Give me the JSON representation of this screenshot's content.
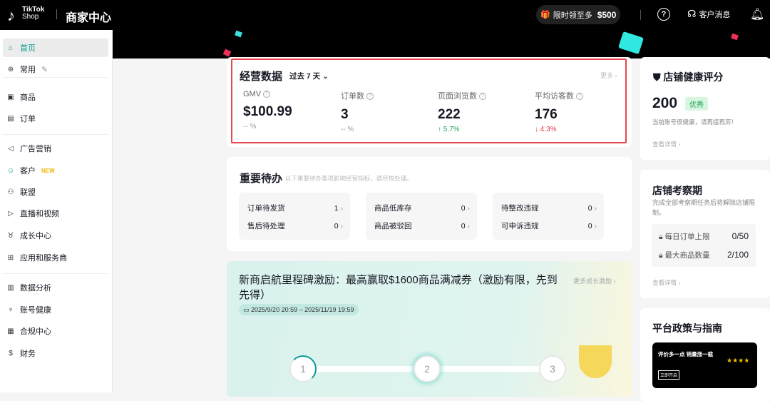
{
  "header": {
    "logo_line1": "TikTok",
    "logo_line2": "Shop",
    "title": "商家中心",
    "promo_text": "限时领至多",
    "promo_amount": "$500",
    "help_icon": "question-circle-icon",
    "support_label": "客户消息",
    "bell_icon": "bell-icon"
  },
  "sidebar": {
    "items": [
      {
        "label": "首页",
        "icon": "home-icon"
      },
      {
        "label": "常用",
        "icon": "star-circle-icon"
      },
      {
        "label": "商品",
        "icon": "box-icon"
      },
      {
        "label": "订单",
        "icon": "clipboard-icon"
      },
      {
        "label": "广告营销",
        "icon": "megaphone-icon"
      },
      {
        "label": "客户",
        "icon": "customer-icon",
        "badge": "NEW"
      },
      {
        "label": "联盟",
        "icon": "people-icon"
      },
      {
        "label": "直播和视频",
        "icon": "video-icon"
      },
      {
        "label": "成长中心",
        "icon": "growth-icon"
      },
      {
        "label": "应用和服务商",
        "icon": "apps-icon"
      },
      {
        "label": "数据分析",
        "icon": "chart-icon"
      },
      {
        "label": "账号健康",
        "icon": "trophy-icon"
      },
      {
        "label": "合规中心",
        "icon": "document-icon"
      },
      {
        "label": "财务",
        "icon": "finance-icon"
      }
    ]
  },
  "business": {
    "title": "经营数据",
    "period": "过去 7 天",
    "more": "更多",
    "metrics": [
      {
        "label": "GMV",
        "value": "$100.99",
        "change": "-- %"
      },
      {
        "label": "订单数",
        "value": "3",
        "change": "-- %"
      },
      {
        "label": "页面浏览数",
        "value": "222",
        "change": "5.7%",
        "trend": "up"
      },
      {
        "label": "平均访客数",
        "value": "176",
        "change": "4.3%",
        "trend": "down"
      }
    ]
  },
  "todo": {
    "title": "重要待办",
    "subtitle": "以下重要待办事项影响经营指标，请尽快处理。",
    "groups": [
      [
        {
          "label": "订单待发货",
          "count": "1"
        },
        {
          "label": "售后待处理",
          "count": "0"
        }
      ],
      [
        {
          "label": "商品低库存",
          "count": "0"
        },
        {
          "label": "商品被驳回",
          "count": "0"
        }
      ],
      [
        {
          "label": "待整改违规",
          "count": "0"
        },
        {
          "label": "可申诉违规",
          "count": "0"
        }
      ]
    ]
  },
  "incentive": {
    "title": "新商启航里程碑激励：最高赢取$1600商品满减券（激励有限，先到先得）",
    "more": "更多成长激励",
    "date_range": "2025/9/20 20:59 – 2025/11/19 19:59",
    "milestones": [
      "1",
      "2",
      "3"
    ]
  },
  "health": {
    "title": "店铺健康评分",
    "score": "200",
    "badge": "优秀",
    "desc": "当前账号很健康，请再接再厉！",
    "link": "查看详情"
  },
  "probation": {
    "title": "店铺考察期",
    "desc": "完成全部考察期任务后将解除店铺限制。",
    "rows": [
      {
        "label": "每日订单上限",
        "value": "0/50"
      },
      {
        "label": "最大商品数量",
        "value": "2/100"
      }
    ],
    "link": "查看详情"
  },
  "policy": {
    "title": "平台政策与指南",
    "promo_title": "评价多一点 销量涨一截",
    "promo_button": "立即开启"
  },
  "colors": {
    "accent": "#0a9a91",
    "up": "#20a35a",
    "down": "#e0344a",
    "highlight": "#e5484d"
  }
}
